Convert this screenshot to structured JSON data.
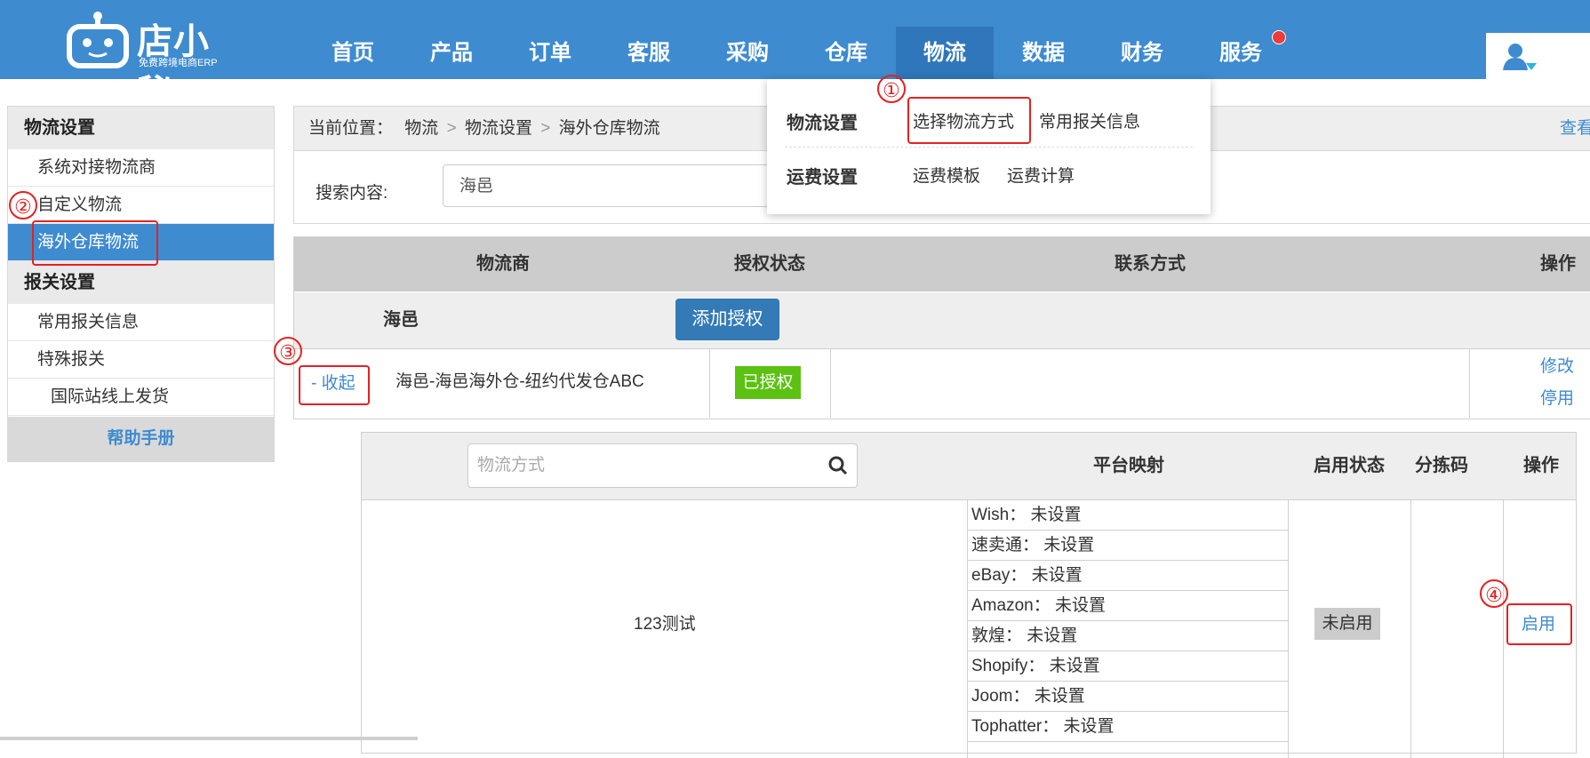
{
  "app": {
    "logo_text": "店小秘",
    "logo_sub": "免费跨境电商ERP"
  },
  "nav": {
    "items": [
      "首页",
      "产品",
      "订单",
      "客服",
      "采购",
      "仓库",
      "物流",
      "数据",
      "财务",
      "服务"
    ],
    "active": "物流"
  },
  "dropdown": {
    "group1_title": "物流设置",
    "group1_link1": "选择物流方式",
    "group1_link2": "常用报关信息",
    "group2_title": "运费设置",
    "group2_link1": "运费模板",
    "group2_link2": "运费计算"
  },
  "sidebar": {
    "section1": "物流设置",
    "items1": [
      "系统对接物流商",
      "自定义物流",
      "海外仓库物流"
    ],
    "section2": "报关设置",
    "items2": [
      "常用报关信息",
      "特殊报关",
      "国际站线上发货"
    ],
    "help": "帮助手册"
  },
  "breadcrumb": {
    "prefix": "当前位置：",
    "path1": "物流",
    "sep": ">",
    "path2": "物流设置",
    "path3": "海外仓库物流",
    "view": "查看"
  },
  "search": {
    "label": "搜索内容:",
    "value": "海邑"
  },
  "provider_table": {
    "headers": [
      "物流商",
      "授权状态",
      "联系方式",
      "操作"
    ],
    "provider_name": "海邑",
    "add_auth_label": "添加授权",
    "collapse_label": "- 收起",
    "account_name": "海邑-海邑海外仓-纽约代发仓ABC",
    "auth_status": "已授权",
    "op_edit": "修改",
    "op_disable": "停用"
  },
  "method_table": {
    "search_placeholder": "物流方式",
    "headers": [
      "平台映射",
      "启用状态",
      "分拣码",
      "操作"
    ],
    "method_name": "123测试",
    "platforms": [
      "Wish：  未设置",
      "速卖通：  未设置",
      "eBay：  未设置",
      "Amazon：  未设置",
      "敦煌：  未设置",
      "Shopify：  未设置",
      "Joom：  未设置",
      "Tophatter：  未设置"
    ],
    "status": "未启用",
    "action": "启用"
  },
  "annotations": [
    "①",
    "②",
    "③",
    "④"
  ],
  "colors": {
    "brand_blue": "#3e8bd0",
    "annotation_red": "#e62020",
    "auth_green": "#5cc212"
  }
}
